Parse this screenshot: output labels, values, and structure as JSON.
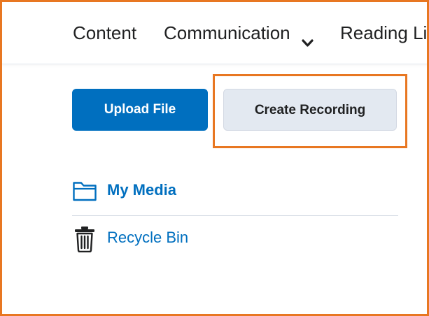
{
  "nav": {
    "items": [
      {
        "label": "Content"
      },
      {
        "label": "Communication"
      },
      {
        "label": "Reading Li"
      }
    ]
  },
  "actions": {
    "upload_label": "Upload File",
    "record_label": "Create Recording"
  },
  "library": {
    "items": [
      {
        "label": "My Media",
        "icon": "folder-icon"
      },
      {
        "label": "Recycle Bin",
        "icon": "trash-icon"
      }
    ]
  },
  "colors": {
    "accent": "#006fbf",
    "highlight": "#e87722",
    "secondary_button": "#e3e9f1"
  }
}
